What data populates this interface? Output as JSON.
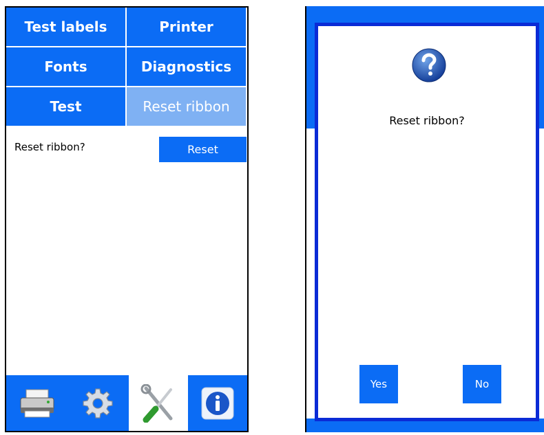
{
  "settings_screen": {
    "tabs": [
      {
        "label": "Test labels",
        "active": false
      },
      {
        "label": "Printer",
        "active": false
      },
      {
        "label": "Fonts",
        "active": false
      },
      {
        "label": "Diagnostics",
        "active": false
      },
      {
        "label": "Test",
        "active": false
      },
      {
        "label": "Reset ribbon",
        "active": true
      }
    ],
    "prompt": "Reset ribbon?",
    "reset_button": "Reset",
    "bottom_nav": [
      {
        "icon": "printer-icon",
        "active": false
      },
      {
        "icon": "gear-icon",
        "active": false
      },
      {
        "icon": "tools-icon",
        "active": true
      },
      {
        "icon": "info-icon",
        "active": false
      }
    ]
  },
  "confirm_dialog": {
    "icon": "question-icon",
    "message": "Reset ribbon?",
    "yes_label": "Yes",
    "no_label": "No"
  },
  "colors": {
    "accent": "#0b6cf5",
    "active_tab": "#7fb1f3",
    "dialog_border": "#0b2bd6"
  }
}
